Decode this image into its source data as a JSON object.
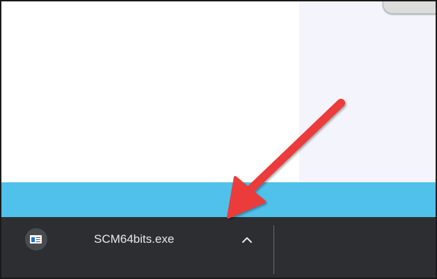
{
  "download_shelf": {
    "file_name": "SCM64bits.exe",
    "file_icon": "windows-app-icon",
    "expand_icon": "chevron-up-icon"
  },
  "annotation": {
    "arrow_color": "#ec3b3b",
    "arrow_icon": "red-arrow-annotation"
  },
  "colors": {
    "page_background": "#ffffff",
    "sidebar_background": "#f3f4fc",
    "accent_band": "#4fc1ea",
    "shelf_background": "#2d2e31",
    "shelf_text": "#e8eaed"
  }
}
